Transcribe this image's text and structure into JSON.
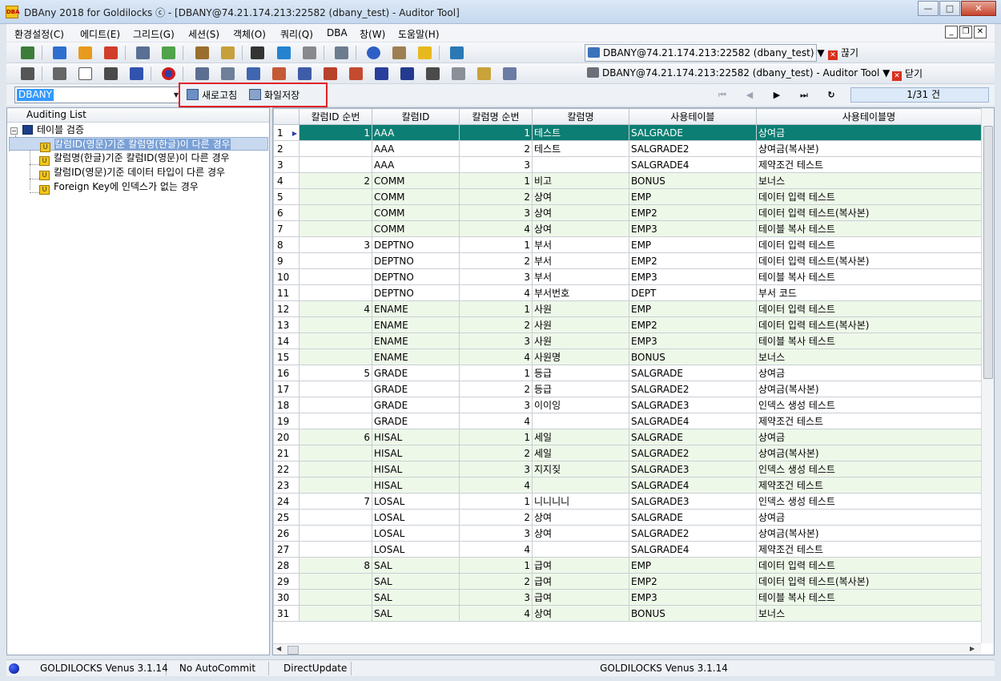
{
  "window": {
    "title": "DBAny 2018 for Goldilocks ⓒ - [DBANY@74.21.174.213:22582 (dbany_test) - Auditor Tool]",
    "icon_text": "DBA"
  },
  "menu": [
    "환경설정(C)",
    "에디트(E)",
    "그리드(G)",
    "세션(S)",
    "객체(O)",
    "쿼리(Q)",
    "DBA",
    "창(W)",
    "도움말(H)"
  ],
  "toolbar": {
    "connection1": "DBANY@74.21.174.213:22582 (dbany_test) ▼",
    "disconnect_label": "끊기",
    "connection2": "DBANY@74.21.174.213:22582 (dbany_test) - Auditor Tool ▼",
    "close_label": "닫기"
  },
  "schema_combo": {
    "value": "DBANY"
  },
  "actions": {
    "refresh_label": "새로고침",
    "save_file_label": "화일저장"
  },
  "nav": {
    "record_count": "1/31 건"
  },
  "tree": {
    "header": "Auditing List",
    "root": "테이블 검증",
    "items": [
      "칼럼ID(영문)기준 칼럼명(한글)이 다른 경우",
      "칼럼명(한글)기준 칼럼ID(영문)이 다른 경우",
      "칼럼ID(영문)기준 데이터 타입이 다른 경우",
      "Foreign Key에 인덱스가 없는 경우"
    ],
    "selected_index": 0
  },
  "grid": {
    "columns": [
      "칼럼ID 순번",
      "칼럼ID",
      "칼럼명 순번",
      "칼럼명",
      "사용테이블",
      "사용테이블명"
    ],
    "rows": [
      {
        "n": "1",
        "seq": "1",
        "cid": "AAA",
        "nseq": "1",
        "name": "테스트",
        "tbl": "SALGRADE",
        "tname": "상여금",
        "g": false
      },
      {
        "n": "2",
        "seq": "",
        "cid": "AAA",
        "nseq": "2",
        "name": "테스트",
        "tbl": "SALGRADE2",
        "tname": "상여금(복사본)",
        "g": false
      },
      {
        "n": "3",
        "seq": "",
        "cid": "AAA",
        "nseq": "3",
        "name": "",
        "tbl": "SALGRADE4",
        "tname": "제약조건 테스트",
        "g": false
      },
      {
        "n": "4",
        "seq": "2",
        "cid": "COMM",
        "nseq": "1",
        "name": "비고",
        "tbl": "BONUS",
        "tname": "보너스",
        "g": true
      },
      {
        "n": "5",
        "seq": "",
        "cid": "COMM",
        "nseq": "2",
        "name": "상여",
        "tbl": "EMP",
        "tname": "데이터 입력 테스트",
        "g": true
      },
      {
        "n": "6",
        "seq": "",
        "cid": "COMM",
        "nseq": "3",
        "name": "상여",
        "tbl": "EMP2",
        "tname": "데이터 입력 테스트(복사본)",
        "g": true
      },
      {
        "n": "7",
        "seq": "",
        "cid": "COMM",
        "nseq": "4",
        "name": "상여",
        "tbl": "EMP3",
        "tname": "테이블 복사 테스트",
        "g": true
      },
      {
        "n": "8",
        "seq": "3",
        "cid": "DEPTNO",
        "nseq": "1",
        "name": "부서",
        "tbl": "EMP",
        "tname": "데이터 입력 테스트",
        "g": false
      },
      {
        "n": "9",
        "seq": "",
        "cid": "DEPTNO",
        "nseq": "2",
        "name": "부서",
        "tbl": "EMP2",
        "tname": "데이터 입력 테스트(복사본)",
        "g": false
      },
      {
        "n": "10",
        "seq": "",
        "cid": "DEPTNO",
        "nseq": "3",
        "name": "부서",
        "tbl": "EMP3",
        "tname": "테이블 복사 테스트",
        "g": false
      },
      {
        "n": "11",
        "seq": "",
        "cid": "DEPTNO",
        "nseq": "4",
        "name": "부서번호",
        "tbl": "DEPT",
        "tname": "부서 코드",
        "g": false
      },
      {
        "n": "12",
        "seq": "4",
        "cid": "ENAME",
        "nseq": "1",
        "name": "사원",
        "tbl": "EMP",
        "tname": "데이터 입력 테스트",
        "g": true
      },
      {
        "n": "13",
        "seq": "",
        "cid": "ENAME",
        "nseq": "2",
        "name": "사원",
        "tbl": "EMP2",
        "tname": "데이터 입력 테스트(복사본)",
        "g": true
      },
      {
        "n": "14",
        "seq": "",
        "cid": "ENAME",
        "nseq": "3",
        "name": "사원",
        "tbl": "EMP3",
        "tname": "테이블 복사 테스트",
        "g": true
      },
      {
        "n": "15",
        "seq": "",
        "cid": "ENAME",
        "nseq": "4",
        "name": "사원명",
        "tbl": "BONUS",
        "tname": "보너스",
        "g": true
      },
      {
        "n": "16",
        "seq": "5",
        "cid": "GRADE",
        "nseq": "1",
        "name": "등급",
        "tbl": "SALGRADE",
        "tname": "상여금",
        "g": false
      },
      {
        "n": "17",
        "seq": "",
        "cid": "GRADE",
        "nseq": "2",
        "name": "등급",
        "tbl": "SALGRADE2",
        "tname": "상여금(복사본)",
        "g": false
      },
      {
        "n": "18",
        "seq": "",
        "cid": "GRADE",
        "nseq": "3",
        "name": "이이잉",
        "tbl": "SALGRADE3",
        "tname": "인덱스 생성 테스트",
        "g": false
      },
      {
        "n": "19",
        "seq": "",
        "cid": "GRADE",
        "nseq": "4",
        "name": "",
        "tbl": "SALGRADE4",
        "tname": "제약조건 테스트",
        "g": false
      },
      {
        "n": "20",
        "seq": "6",
        "cid": "HISAL",
        "nseq": "1",
        "name": "세일",
        "tbl": "SALGRADE",
        "tname": "상여금",
        "g": true
      },
      {
        "n": "21",
        "seq": "",
        "cid": "HISAL",
        "nseq": "2",
        "name": "세일",
        "tbl": "SALGRADE2",
        "tname": "상여금(복사본)",
        "g": true
      },
      {
        "n": "22",
        "seq": "",
        "cid": "HISAL",
        "nseq": "3",
        "name": "지지짖",
        "tbl": "SALGRADE3",
        "tname": "인덱스 생성 테스트",
        "g": true
      },
      {
        "n": "23",
        "seq": "",
        "cid": "HISAL",
        "nseq": "4",
        "name": "",
        "tbl": "SALGRADE4",
        "tname": "제약조건 테스트",
        "g": true
      },
      {
        "n": "24",
        "seq": "7",
        "cid": "LOSAL",
        "nseq": "1",
        "name": "니니니니",
        "tbl": "SALGRADE3",
        "tname": "인덱스 생성 테스트",
        "g": false
      },
      {
        "n": "25",
        "seq": "",
        "cid": "LOSAL",
        "nseq": "2",
        "name": "상여",
        "tbl": "SALGRADE",
        "tname": "상여금",
        "g": false
      },
      {
        "n": "26",
        "seq": "",
        "cid": "LOSAL",
        "nseq": "3",
        "name": "상여",
        "tbl": "SALGRADE2",
        "tname": "상여금(복사본)",
        "g": false
      },
      {
        "n": "27",
        "seq": "",
        "cid": "LOSAL",
        "nseq": "4",
        "name": "",
        "tbl": "SALGRADE4",
        "tname": "제약조건 테스트",
        "g": false
      },
      {
        "n": "28",
        "seq": "8",
        "cid": "SAL",
        "nseq": "1",
        "name": "급여",
        "tbl": "EMP",
        "tname": "데이터 입력 테스트",
        "g": true
      },
      {
        "n": "29",
        "seq": "",
        "cid": "SAL",
        "nseq": "2",
        "name": "급여",
        "tbl": "EMP2",
        "tname": "데이터 입력 테스트(복사본)",
        "g": true
      },
      {
        "n": "30",
        "seq": "",
        "cid": "SAL",
        "nseq": "3",
        "name": "급여",
        "tbl": "EMP3",
        "tname": "테이블 복사 테스트",
        "g": true
      },
      {
        "n": "31",
        "seq": "",
        "cid": "SAL",
        "nseq": "4",
        "name": "상여",
        "tbl": "BONUS",
        "tname": "보너스",
        "g": true
      }
    ]
  },
  "status": {
    "db_version": "GOLDILOCKS Venus 3.1.14",
    "autocommit": "No AutoCommit",
    "update_mode": "DirectUpdate",
    "db_version_right": "GOLDILOCKS Venus 3.1.14"
  },
  "colors": {
    "selected_row": "#0c7e73",
    "group_row": "#eef8e9",
    "highlight_border": "#e32229"
  }
}
